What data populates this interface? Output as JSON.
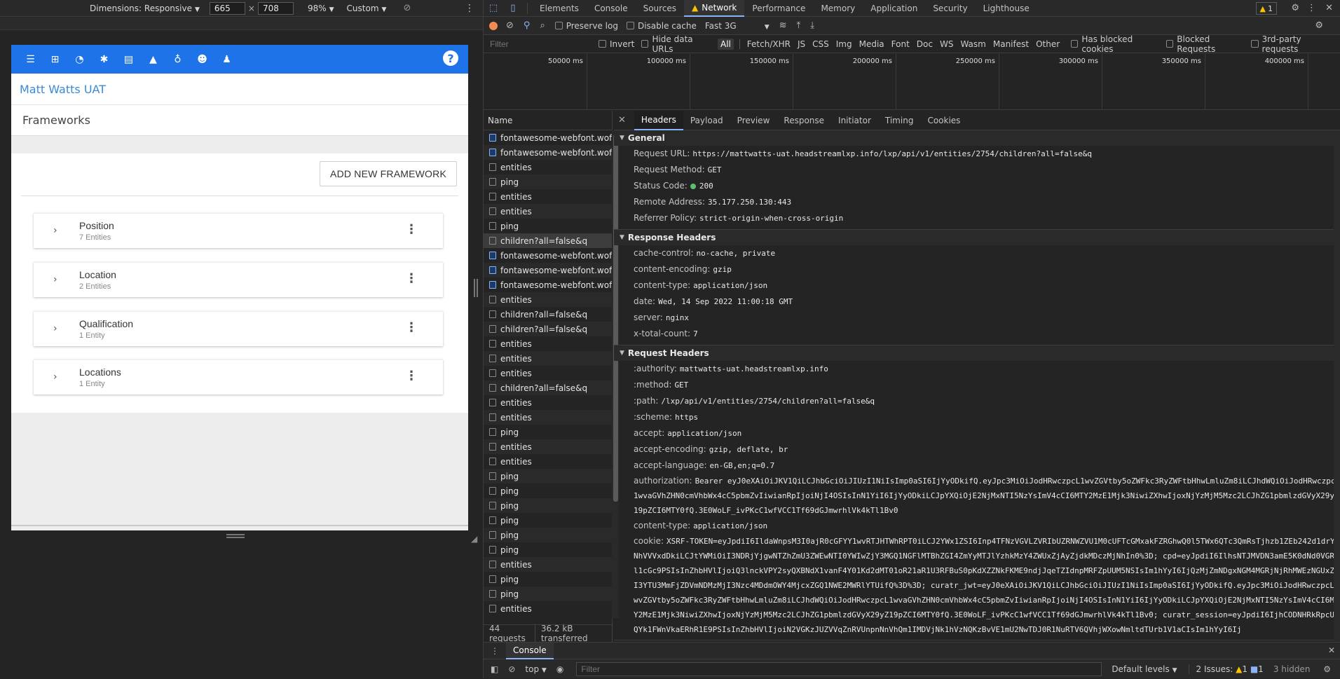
{
  "device_toolbar": {
    "dimensions_label": "Dimensions: Responsive",
    "width": "665",
    "height": "708",
    "zoom": "98%",
    "throttle": "Custom"
  },
  "app": {
    "brand": "Matt Watts UAT",
    "page_title": "Frameworks",
    "add_button": "ADD NEW FRAMEWORK",
    "help_symbol": "?",
    "accent_color": "#1e73e8",
    "nav_icons": [
      "menu-icon",
      "sitemap-icon",
      "dashboard-icon",
      "gear-icon",
      "file-icon",
      "graduation-cap-icon",
      "lightbulb-icon",
      "users-icon",
      "user-icon"
    ],
    "frameworks": [
      {
        "name": "Position",
        "count": "7 Entities"
      },
      {
        "name": "Location",
        "count": "2 Entities"
      },
      {
        "name": "Qualification",
        "count": "1 Entity"
      },
      {
        "name": "Locations",
        "count": "1 Entity"
      }
    ]
  },
  "devtools": {
    "tabs": [
      "Elements",
      "Console",
      "Sources",
      "Network",
      "Performance",
      "Memory",
      "Application",
      "Security",
      "Lighthouse"
    ],
    "active_tab": "Network",
    "issue_count": "1",
    "toolbar": {
      "preserve_log": "Preserve log",
      "disable_cache": "Disable cache",
      "throttling": "Fast 3G"
    },
    "filter": {
      "placeholder": "Filter",
      "invert": "Invert",
      "hide_data_urls": "Hide data URLs",
      "types": [
        "All",
        "Fetch/XHR",
        "JS",
        "CSS",
        "Img",
        "Media",
        "Font",
        "Doc",
        "WS",
        "Wasm",
        "Manifest",
        "Other"
      ],
      "has_blocked_cookies": "Has blocked cookies",
      "blocked_requests": "Blocked Requests",
      "third_party": "3rd-party requests"
    },
    "overview_ticks": [
      "50000 ms",
      "100000 ms",
      "150000 ms",
      "200000 ms",
      "250000 ms",
      "300000 ms",
      "350000 ms",
      "400000 ms"
    ],
    "requests_header": "Name",
    "requests": [
      {
        "name": "fontawesome-webfont.woff2?",
        "type": "font"
      },
      {
        "name": "fontawesome-webfont.woff2?",
        "type": "font"
      },
      {
        "name": "entities",
        "type": "doc"
      },
      {
        "name": "ping",
        "type": "doc"
      },
      {
        "name": "entities",
        "type": "doc"
      },
      {
        "name": "entities",
        "type": "doc"
      },
      {
        "name": "ping",
        "type": "doc"
      },
      {
        "name": "children?all=false&q",
        "type": "doc",
        "selected": true
      },
      {
        "name": "fontawesome-webfont.woff2?",
        "type": "font"
      },
      {
        "name": "fontawesome-webfont.woff2?",
        "type": "font"
      },
      {
        "name": "fontawesome-webfont.woff2?",
        "type": "font"
      },
      {
        "name": "entities",
        "type": "doc"
      },
      {
        "name": "children?all=false&q",
        "type": "doc"
      },
      {
        "name": "children?all=false&q",
        "type": "doc"
      },
      {
        "name": "entities",
        "type": "doc"
      },
      {
        "name": "entities",
        "type": "doc"
      },
      {
        "name": "entities",
        "type": "doc"
      },
      {
        "name": "children?all=false&q",
        "type": "doc"
      },
      {
        "name": "entities",
        "type": "doc"
      },
      {
        "name": "entities",
        "type": "doc"
      },
      {
        "name": "ping",
        "type": "doc"
      },
      {
        "name": "entities",
        "type": "doc"
      },
      {
        "name": "entities",
        "type": "doc"
      },
      {
        "name": "ping",
        "type": "doc"
      },
      {
        "name": "ping",
        "type": "doc"
      },
      {
        "name": "ping",
        "type": "doc"
      },
      {
        "name": "ping",
        "type": "doc"
      },
      {
        "name": "ping",
        "type": "doc"
      },
      {
        "name": "ping",
        "type": "doc"
      },
      {
        "name": "entities",
        "type": "doc"
      },
      {
        "name": "ping",
        "type": "doc"
      },
      {
        "name": "ping",
        "type": "doc"
      },
      {
        "name": "entities",
        "type": "doc"
      }
    ],
    "summary": {
      "requests": "44 requests",
      "transferred": "36.2 kB transferred"
    },
    "detail_tabs": [
      "Headers",
      "Payload",
      "Preview",
      "Response",
      "Initiator",
      "Timing",
      "Cookies"
    ],
    "active_detail_tab": "Headers",
    "general": {
      "title": "General",
      "rows": [
        {
          "k": "Request URL:",
          "v": "https://mattwatts-uat.headstreamlxp.info/lxp/api/v1/entities/2754/children?all=false&q"
        },
        {
          "k": "Request Method:",
          "v": "GET"
        },
        {
          "k": "Status Code:",
          "v": "200",
          "status": true
        },
        {
          "k": "Remote Address:",
          "v": "35.177.250.130:443"
        },
        {
          "k": "Referrer Policy:",
          "v": "strict-origin-when-cross-origin"
        }
      ]
    },
    "response_headers": {
      "title": "Response Headers",
      "rows": [
        {
          "k": "cache-control:",
          "v": "no-cache, private"
        },
        {
          "k": "content-encoding:",
          "v": "gzip"
        },
        {
          "k": "content-type:",
          "v": "application/json"
        },
        {
          "k": "date:",
          "v": "Wed, 14 Sep 2022 11:00:18 GMT"
        },
        {
          "k": "server:",
          "v": "nginx"
        },
        {
          "k": "x-total-count:",
          "v": "7"
        }
      ]
    },
    "request_headers": {
      "title": "Request Headers",
      "rows": [
        {
          "k": ":authority:",
          "v": "mattwatts-uat.headstreamlxp.info"
        },
        {
          "k": ":method:",
          "v": "GET"
        },
        {
          "k": ":path:",
          "v": "/lxp/api/v1/entities/2754/children?all=false&q"
        },
        {
          "k": ":scheme:",
          "v": "https"
        },
        {
          "k": "accept:",
          "v": "application/json"
        },
        {
          "k": "accept-encoding:",
          "v": "gzip, deflate, br"
        },
        {
          "k": "accept-language:",
          "v": "en-GB,en;q=0.7"
        },
        {
          "k": "authorization:",
          "v": "Bearer eyJ0eXAiOiJKV1QiLCJhbGciOiJIUzI1NiIsImp0aSI6IjYyODkifQ.eyJpc3MiOiJodHRwczpcL1wvZGVtby5oZWFkc3RyZWFtbHhwLmluZm8iLCJhdWQiOiJodHRwczpcL1wvaGVhZHN0cmVhbWx4cC5pbmZvIiwianRpIjoiNjI4OSIsInN1YiI6IjYyODkiLCJpYXQiOjE2NjMxNTI5NzYsImV4cCI6MTY2MzE1Mjk3NiwiZXhwIjoxNjYzMjM5Mzc2LCJhZG1pbmlzdGVyX29yZ19pZCI6MTY0fQ.3E0WoLF_ivPKcC1wfVCC1Tf69dGJmwrhlVk4kTl1Bv0",
          "wrap": true
        },
        {
          "k": "content-type:",
          "v": "application/json"
        },
        {
          "k": "cookie:",
          "v": "XSRF-TOKEN=eyJpdiI6IldaWnpsM3I0ajR0cGFYY1wvRTJHTWhRPT0iLCJ2YWx1ZSI6Inp4TFNzVGVLZVRIbUZRNWZVU1M0cUFTcGMxakFZRGhwQ0l5TWx6QTc3QmRsTjhzb1ZEb242d1drYWNhVVVxdDkiLCJtYWMiOiI3NDRjYjgwNTZhZmU3ZWEwNTI0YWIwZjY3MGQ1NGFlMTBhZGI4ZmYyMTJlYzhkMzY4ZWUxZjAyZjdkMDczMjNhIn0%3D; cpd=eyJpdiI6IlhsNTJMVDN3amE5K0dNd0VGRll1cGc9PSIsInZhbHVlIjoiQ3lnckVPY2syQXBNdX1vanF4Y01Kd2dMT01oR21aR1U3RFBuS0pKdXZZNkFKME9ndjJqeTZIdnpMRFZpUUM5NSIsIm1hYyI6IjQzMjZmNDgxNGM4MGRjNjRhMWEzNGUxZWI3YTU3MmFjZDVmNDMzMjI3Nzc4MDdmOWY4MjcxZGQ1NWE2MWRlYTUifQ%3D%3D; curatr_jwt=eyJ0eXAiOiJKV1QiLCJhbGciOiJIUzI1NiIsImp0aSI6IjYyODkifQ.eyJpc3MiOiJodHRwczpcL1wvZGVtby5oZWFkc3RyZWFtbHhwLmluZm8iLCJhdWQiOiJodHRwczpcL1wvaGVhZHN0cmVhbWx4cC5pbmZvIiwianRpIjoiNjI4OSIsInN1YiI6IjYyODkiLCJpYXQiOjE2NjMxNTI5NzYsImV4cCI6MTY2MzE1Mjk3NiwiZXhwIjoxNjYzMjM5Mzc2LCJhZG1pbmlzdGVyX29yZ19pZCI6MTY0fQ.3E0WoLF_ivPKcC1wfVCC1Tf69dGJmwrhlVk4kTl1Bv0; curatr_session=eyJpdiI6IjhCODNHRkRpcUxQYk1FWnVkaERhR1E9PSIsInZhbHVlIjoiN2VGKzJUZVVqZnRVUnpnNnVhQm1IMDVjNk1hVzNQKzBvVE1mU2NwTDJ0R1NuRTV6QVhjWXowNmltdTUrb1V1aCIsIm1hYyI6Ij",
          "wrap": true
        }
      ]
    },
    "console": {
      "tab": "Console",
      "context": "top",
      "filter_placeholder": "Filter",
      "levels": "Default levels",
      "issues_label": "2 Issues:",
      "issues_warn": "1",
      "issues_info": "1",
      "hidden": "3 hidden"
    }
  }
}
